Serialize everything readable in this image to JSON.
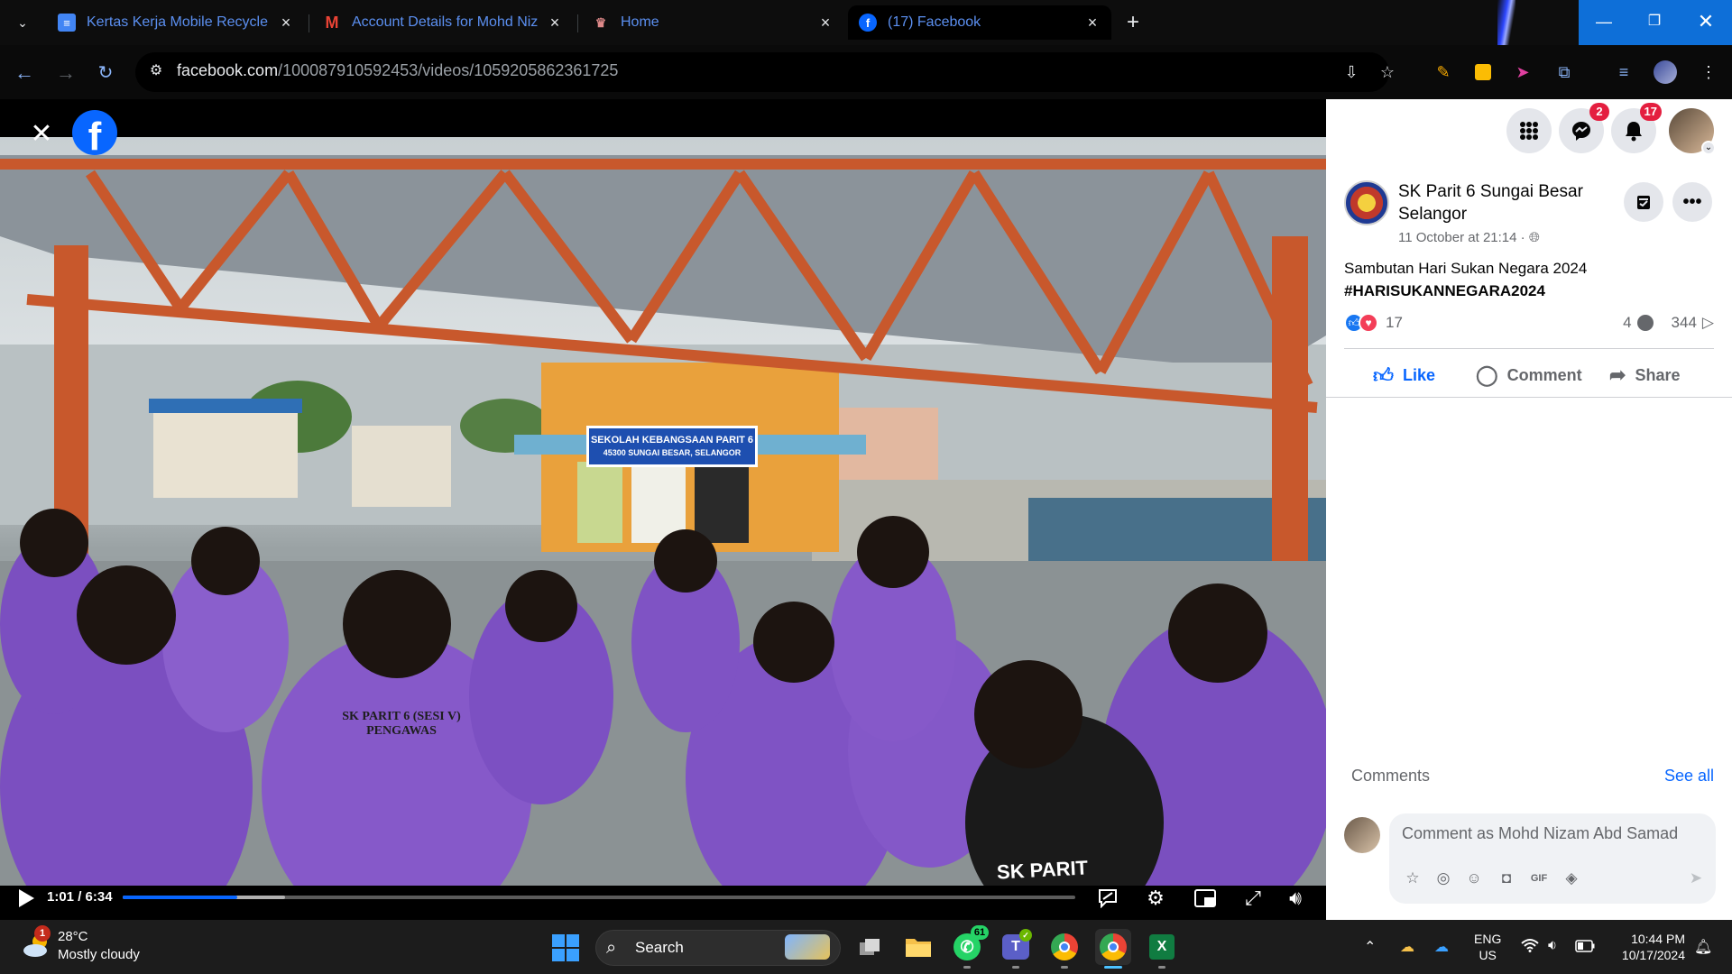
{
  "browser": {
    "tabs": [
      {
        "title": "Kertas Kerja Mobile Recycler PS",
        "favicon": "docs-icon",
        "color": "#4285f4"
      },
      {
        "title": "Account Details for Mohd Nizam",
        "favicon": "gmail-icon",
        "color": "#ea4335"
      },
      {
        "title": "Home",
        "favicon": "home-site-icon",
        "color": "#b44"
      },
      {
        "title": "(17) Facebook",
        "favicon": "facebook-icon",
        "color": "#0866ff"
      }
    ],
    "url_domain": "facebook.com",
    "url_path": "/100087910592453/videos/1059205862361725"
  },
  "video": {
    "school_sign": "SEKOLAH KEBANGSAAN PARIT 6",
    "school_sign_sub": "45300 SUNGAI BESAR, SELANGOR",
    "shirt_text": "SK PARIT 6 (SESI V)",
    "shirt_sub": "PENGAWAS",
    "jersey_text": "SK PARIT",
    "time": "1:01 / 6:34",
    "progress": 0.12,
    "buffered": 0.17
  },
  "panel": {
    "messenger_badge": "2",
    "notifications_badge": "17",
    "page_name": "SK Parit 6 Sungai Besar Selangor",
    "post_time": "11 October at 21:14 · ",
    "caption_line1": "Sambutan Hari Sukan Negara 2024",
    "caption_line2": "#HARISUKANNEGARA2024",
    "reactions_count": "17",
    "comments_count": "4",
    "views_count": "344",
    "like_label": "Like",
    "comment_label": "Comment",
    "share_label": "Share",
    "comments_heading": "Comments",
    "see_all_label": "See all",
    "comment_placeholder": "Comment as Mohd Nizam Abd Samad"
  },
  "taskbar": {
    "weather_badge": "1",
    "temperature": "28°C",
    "weather_desc": "Mostly cloudy",
    "search_label": "Search",
    "whatsapp_badge": "61",
    "lang_line1": "ENG",
    "lang_line2": "US",
    "time": "10:44 PM",
    "date": "10/17/2024"
  }
}
